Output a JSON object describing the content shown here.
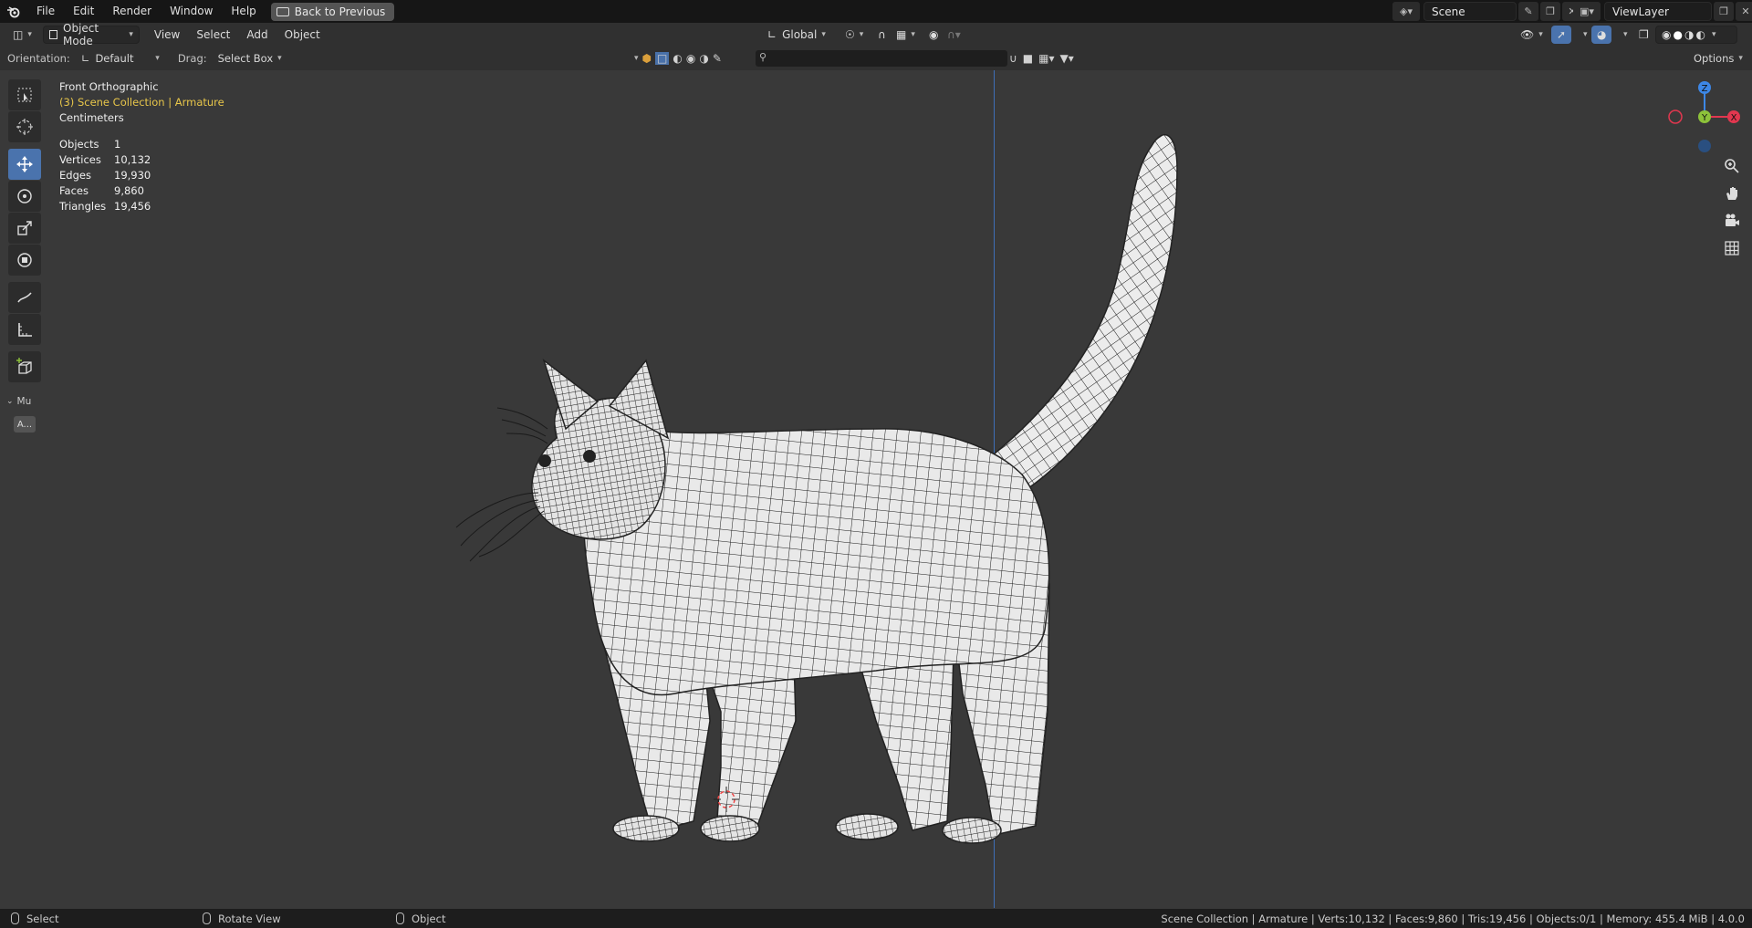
{
  "menu": {
    "items": [
      "File",
      "Edit",
      "Render",
      "Window",
      "Help"
    ],
    "back_button": "Back to Previous"
  },
  "scene": {
    "name": "Scene",
    "view_layer": "ViewLayer"
  },
  "header": {
    "mode": "Object Mode",
    "menus": [
      "View",
      "Select",
      "Add",
      "Object"
    ],
    "transform_orientation": "Global",
    "options_label": "Options"
  },
  "tool_settings": {
    "orientation_label": "Orientation:",
    "orientation_value": "Default",
    "drag_label": "Drag:",
    "drag_value": "Select Box"
  },
  "overlay": {
    "view_name": "Front Orthographic",
    "collection_prefix": "(3) Scene Collection | Armature",
    "units": "Centimeters",
    "stats": [
      {
        "label": "Objects",
        "value": "1"
      },
      {
        "label": "Vertices",
        "value": "10,132"
      },
      {
        "label": "Edges",
        "value": "19,930"
      },
      {
        "label": "Faces",
        "value": "9,860"
      },
      {
        "label": "Triangles",
        "value": "19,456"
      }
    ]
  },
  "toolbar": {
    "panel_label": "Mu",
    "bottom_button": "A..."
  },
  "gizmo": {
    "x": "X",
    "y": "Y",
    "z": "Z"
  },
  "statusbar": {
    "select": "Select",
    "rotate": "Rotate View",
    "object": "Object",
    "info": "Scene Collection | Armature | Verts:10,132 | Faces:9,860 | Tris:19,456 | Objects:0/1 | Memory: 455.4 MiB | 4.0.0"
  },
  "colors": {
    "accent": "#4a73ad",
    "axis_x": "#e2374f",
    "axis_y": "#8dc23a",
    "axis_z": "#3d87e6",
    "collection_text": "#e8c64a"
  }
}
